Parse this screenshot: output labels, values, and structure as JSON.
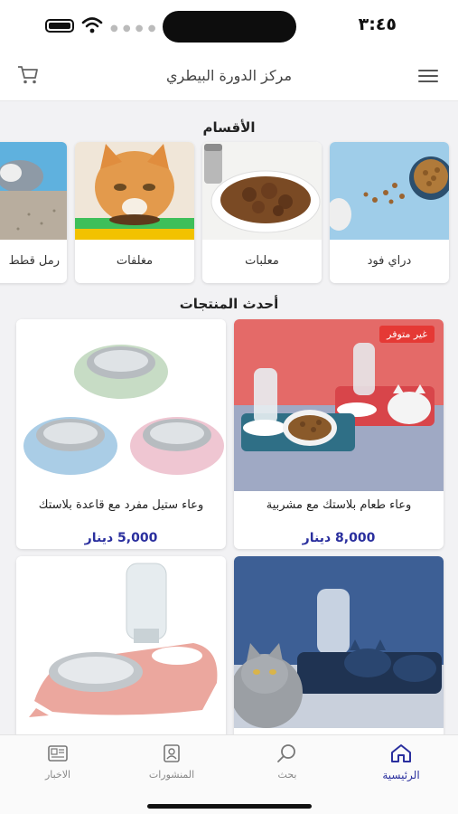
{
  "status_bar": {
    "time": "٣:٤٥"
  },
  "header": {
    "title": "مركز الدورة البيطري"
  },
  "categories_section": {
    "title": "الأقسام",
    "items": [
      {
        "label": "دراي فود"
      },
      {
        "label": "معلبات"
      },
      {
        "label": "مغلفات"
      },
      {
        "label": "رمل قطط"
      }
    ]
  },
  "products_section": {
    "title": "أحدث المنتجات",
    "items": [
      {
        "name": "وعاء طعام بلاستك مع مشربية",
        "price": "8,000 دينار",
        "badge": "غير متوفر"
      },
      {
        "name": "وعاء ستيل مفرد مع قاعدة بلاستك",
        "price": "5,000 دينار",
        "badge": ""
      },
      {
        "name": "",
        "price": "",
        "badge": ""
      },
      {
        "name": "",
        "price": "",
        "badge": ""
      }
    ]
  },
  "tab_bar": {
    "tabs": [
      {
        "label": "الرئيسية",
        "icon": "home-icon",
        "active": true
      },
      {
        "label": "بحث",
        "icon": "search-icon",
        "active": false
      },
      {
        "label": "المنشورات",
        "icon": "posts-icon",
        "active": false
      },
      {
        "label": "الاخبار",
        "icon": "news-icon",
        "active": false
      }
    ]
  },
  "colors": {
    "accent": "#2a2f9e",
    "badge": "#e53935",
    "background": "#f2f2f4"
  }
}
